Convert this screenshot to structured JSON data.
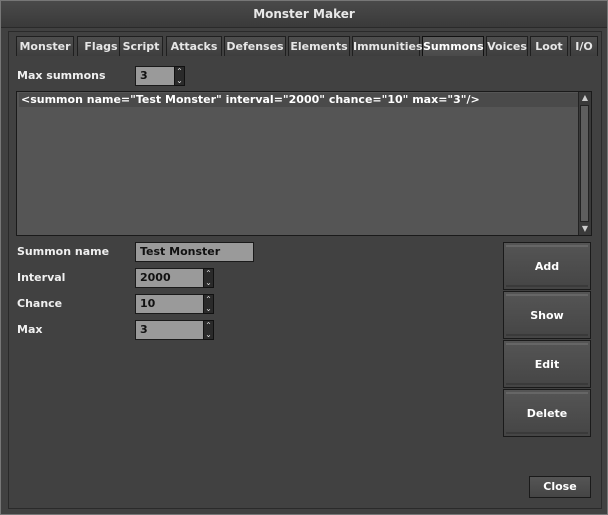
{
  "window": {
    "title": "Monster Maker"
  },
  "tabs": [
    {
      "label": "Monster"
    },
    {
      "label": "Flags"
    },
    {
      "label": "Script"
    },
    {
      "label": "Attacks"
    },
    {
      "label": "Defenses"
    },
    {
      "label": "Elements"
    },
    {
      "label": "Immunities"
    },
    {
      "label": "Summons"
    },
    {
      "label": "Voices"
    },
    {
      "label": "Loot"
    },
    {
      "label": "I/O"
    }
  ],
  "active_tab": "Summons",
  "max_summons": {
    "label": "Max summons",
    "value": "3"
  },
  "summon_list": [
    "<summon name=\"Test Monster\" interval=\"2000\" chance=\"10\" max=\"3\"/>"
  ],
  "form": {
    "summon_name": {
      "label": "Summon name",
      "value": "Test Monster"
    },
    "interval": {
      "label": "Interval",
      "value": "2000"
    },
    "chance": {
      "label": "Chance",
      "value": "10"
    },
    "max": {
      "label": "Max",
      "value": "3"
    }
  },
  "buttons": {
    "add": "Add",
    "show": "Show",
    "edit": "Edit",
    "delete": "Delete",
    "close": "Close"
  },
  "icons": {
    "spin_up": "chevron-up-icon",
    "spin_down": "chevron-down-icon"
  }
}
